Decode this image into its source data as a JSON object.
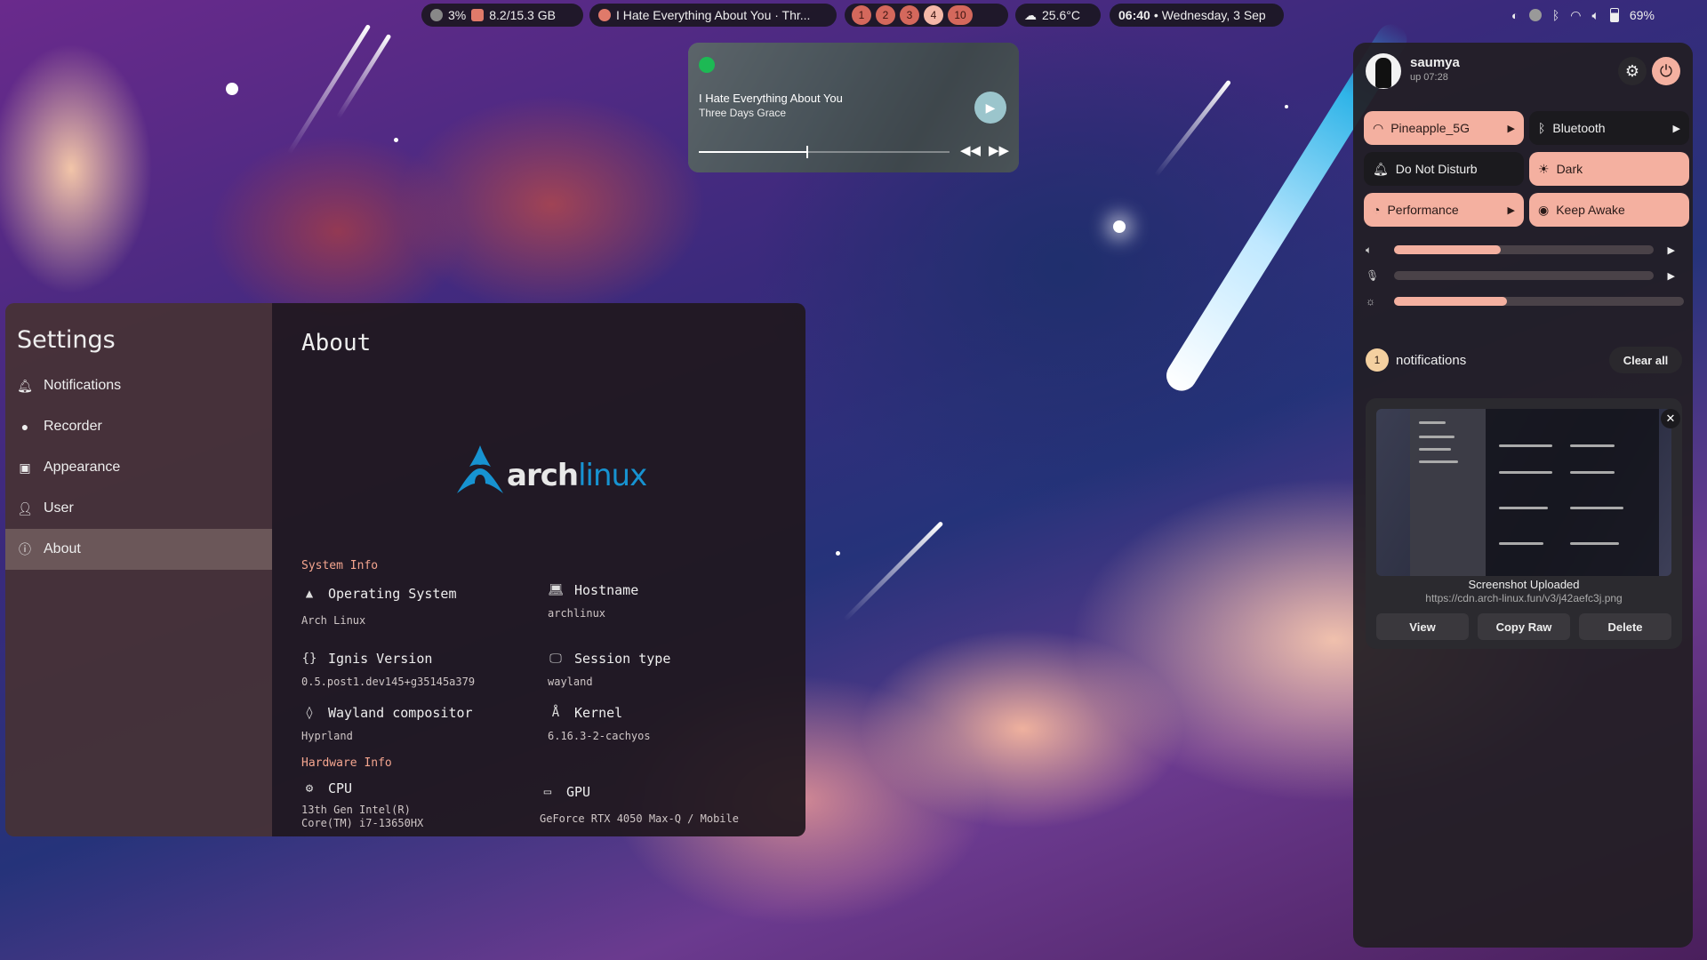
{
  "topbar": {
    "cpu": "3%",
    "ram": "8.2/15.3 GB",
    "now_playing": "I Hate Everything About You · Thr...",
    "workspaces": [
      "1",
      "2",
      "3",
      "4",
      "10"
    ],
    "active_workspace": "4",
    "weather": "25.6°C",
    "clock_time": "06:40",
    "clock_date": "Wednesday, 3 Sep",
    "battery": "69%"
  },
  "player": {
    "title": "I Hate Everything About You",
    "artist": "Three Days Grace",
    "progress": 0.43
  },
  "settings": {
    "title": "Settings",
    "sidebar": [
      {
        "label": "Notifications",
        "icon": "bell-icon"
      },
      {
        "label": "Recorder",
        "icon": "record-icon"
      },
      {
        "label": "Appearance",
        "icon": "appearance-icon"
      },
      {
        "label": "User",
        "icon": "user-icon"
      },
      {
        "label": "About",
        "icon": "info-icon",
        "active": true
      }
    ],
    "page_title": "About",
    "logo": {
      "word_bold": "arch",
      "word_light": "linux"
    },
    "system_info_label": "System Info",
    "hardware_info_label": "Hardware Info",
    "os": {
      "label": "Operating System",
      "value": "Arch Linux"
    },
    "hostname": {
      "label": "Hostname",
      "value": "archlinux"
    },
    "ignis": {
      "label": "Ignis Version",
      "value": "0.5.post1.dev145+g35145a379"
    },
    "session": {
      "label": "Session type",
      "value": "wayland"
    },
    "compositor": {
      "label": "Wayland compositor",
      "value": "Hyprland"
    },
    "kernel": {
      "label": "Kernel",
      "value": "6.16.3-2-cachyos"
    },
    "cpu": {
      "label": "CPU",
      "value_line1": "13th Gen Intel(R)",
      "value_line2": "Core(TM) i7-13650HX"
    },
    "gpu": {
      "label": "GPU",
      "value": "GeForce RTX 4050 Max-Q / Mobile"
    }
  },
  "control_center": {
    "username": "saumya",
    "uptime": "up 07:28",
    "tiles": [
      {
        "label": "Pineapple_5G",
        "icon": "wifi-icon",
        "on": true,
        "arrow": true
      },
      {
        "label": "Bluetooth",
        "icon": "bluetooth-icon",
        "on": false,
        "arrow": true
      },
      {
        "label": "Do Not Disturb",
        "icon": "bell-icon",
        "on": false,
        "arrow": false
      },
      {
        "label": "Dark",
        "icon": "sun-icon",
        "on": true,
        "arrow": false
      },
      {
        "label": "Performance",
        "icon": "gauge-icon",
        "on": true,
        "arrow": true
      },
      {
        "label": "Keep Awake",
        "icon": "eye-icon",
        "on": true,
        "arrow": false
      }
    ],
    "sliders": [
      {
        "icon": "volume-icon",
        "level": 0.41
      },
      {
        "icon": "mic-muted-icon",
        "level": 0.0
      },
      {
        "icon": "brightness-icon",
        "level": 0.39
      }
    ],
    "notifications_count": "1",
    "notifications_label": "notifications",
    "clear_all": "Clear all",
    "notification": {
      "title": "Screenshot Uploaded",
      "url": "https://cdn.arch-linux.fun/v3/j42aefc3j.png",
      "actions": [
        "View",
        "Copy Raw",
        "Delete"
      ]
    }
  }
}
